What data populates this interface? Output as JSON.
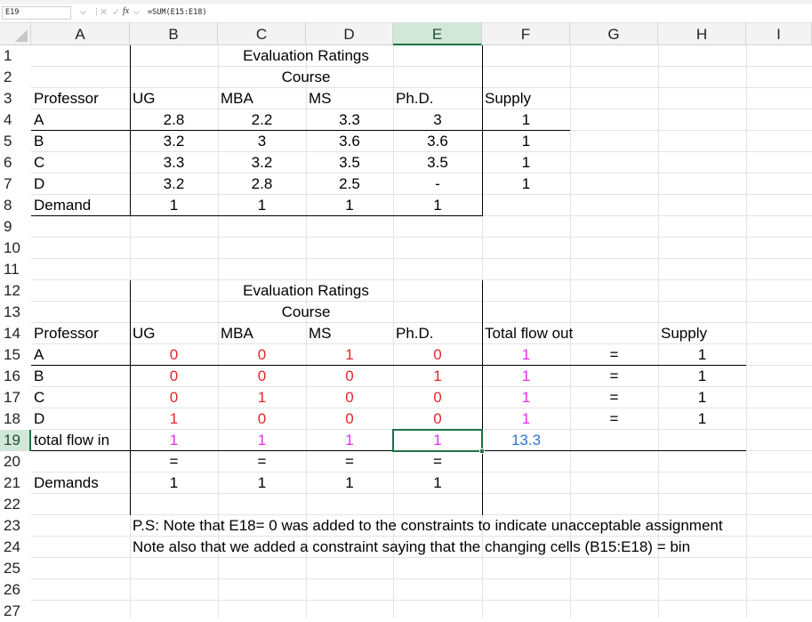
{
  "formula_bar": {
    "name_box": "E19",
    "formula": "=SUM(E15:E18)",
    "cancel_icon": "x-icon",
    "enter_icon": "check-icon",
    "fx_label": "fx"
  },
  "columns": [
    "A",
    "B",
    "C",
    "D",
    "E",
    "F",
    "G",
    "H",
    "I"
  ],
  "rows": [
    "1",
    "2",
    "3",
    "4",
    "5",
    "6",
    "7",
    "8",
    "9",
    "10",
    "11",
    "12",
    "13",
    "14",
    "15",
    "16",
    "17",
    "18",
    "19",
    "20",
    "21",
    "22",
    "23",
    "24",
    "25",
    "26",
    "27"
  ],
  "selected_cell": "E19",
  "top_table": {
    "title": "Evaluation Ratings",
    "subtitle": "Course",
    "headers": [
      "Professor",
      "UG",
      "MBA",
      "MS",
      "Ph.D.",
      "Supply"
    ],
    "rows": [
      {
        "label": "A",
        "values": [
          "2.8",
          "2.2",
          "3.3",
          "3"
        ],
        "supply": "1"
      },
      {
        "label": "B",
        "values": [
          "3.2",
          "3",
          "3.6",
          "3.6"
        ],
        "supply": "1"
      },
      {
        "label": "C",
        "values": [
          "3.3",
          "3.2",
          "3.5",
          "3.5"
        ],
        "supply": "1"
      },
      {
        "label": "D",
        "values": [
          "3.2",
          "2.8",
          "2.5",
          "-"
        ],
        "supply": "1"
      }
    ],
    "demand_label": "Demand",
    "demand": [
      "1",
      "1",
      "1",
      "1"
    ]
  },
  "bottom_table": {
    "title": "Evaluation Ratings",
    "subtitle": "Course",
    "headers": [
      "Professor",
      "UG",
      "MBA",
      "MS",
      "Ph.D.",
      "Total flow out",
      "Supply"
    ],
    "rows": [
      {
        "label": "A",
        "values": [
          "0",
          "0",
          "1",
          "0"
        ],
        "flow_out": "1",
        "eq": "=",
        "supply": "1"
      },
      {
        "label": "B",
        "values": [
          "0",
          "0",
          "0",
          "1"
        ],
        "flow_out": "1",
        "eq": "=",
        "supply": "1"
      },
      {
        "label": "C",
        "values": [
          "0",
          "1",
          "0",
          "0"
        ],
        "flow_out": "1",
        "eq": "=",
        "supply": "1"
      },
      {
        "label": "D",
        "values": [
          "1",
          "0",
          "0",
          "0"
        ],
        "flow_out": "1",
        "eq": "=",
        "supply": "1"
      }
    ],
    "total_flow_in_label": "total flow in",
    "total_flow_in": [
      "1",
      "1",
      "1",
      "1"
    ],
    "objective": "13.3",
    "eq_row": [
      "=",
      "=",
      "=",
      "="
    ],
    "demands_label": "Demands",
    "demands": [
      "1",
      "1",
      "1",
      "1"
    ]
  },
  "notes": [
    "P.S: Note that E18= 0 was added to the constraints to indicate unacceptable assignment",
    "Note also that we added a constraint saying that the changing cells (B15:E18) = bin"
  ],
  "colors": {
    "decision": "#e3262b",
    "flow": "#e62ee6",
    "objective": "#2f74d0",
    "selection": "#1e7145"
  }
}
